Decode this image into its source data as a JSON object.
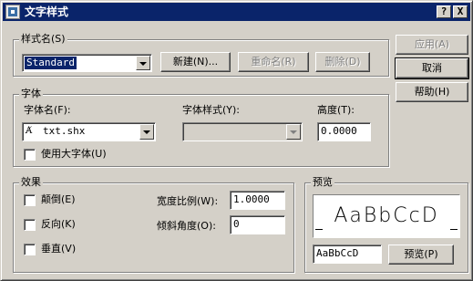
{
  "title": "文字样式",
  "caption": {
    "help": "?",
    "close": "X"
  },
  "buttons": {
    "apply": "应用(A)",
    "cancel": "取消",
    "help": "帮助(H)"
  },
  "style_name": {
    "label": "样式名(S)",
    "value": "Standard",
    "new": "新建(N)...",
    "rename": "重命名(R)",
    "delete": "删除(D)"
  },
  "font": {
    "group": "字体",
    "name_label": "字体名(F):",
    "name_value": "txt.shx",
    "name_icon": "font-a-icon",
    "style_label": "字体样式(Y):",
    "style_value": "",
    "height_label": "高度(T):",
    "height_value": "0.0000",
    "bigfont_label": "使用大字体(U)",
    "bigfont_checked": false
  },
  "effects": {
    "group": "效果",
    "upside_down": "颠倒(E)",
    "backwards": "反向(K)",
    "vertical": "垂直(V)",
    "width_label": "宽度比例(W):",
    "width_value": "1.0000",
    "oblique_label": "倾斜角度(O):",
    "oblique_value": "0"
  },
  "preview": {
    "group": "预览",
    "sample": "AaBbCcD",
    "input_value": "AaBbCcD",
    "button": "预览(P)"
  }
}
